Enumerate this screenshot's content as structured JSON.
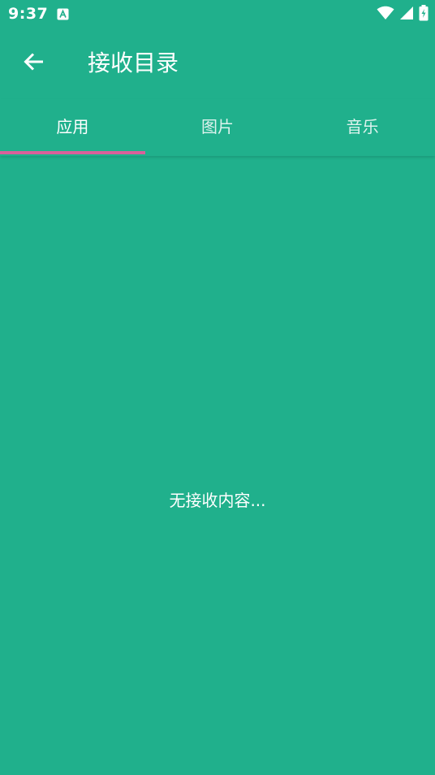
{
  "status_bar": {
    "time": "9:37",
    "notification_icon": "accessibility-a-icon",
    "wifi_icon": "wifi-icon",
    "signal_icon": "cell-signal-icon",
    "battery_icon": "battery-charging-icon"
  },
  "toolbar": {
    "back_icon": "arrow-left-icon",
    "title": "接收目录"
  },
  "tabs": [
    {
      "label": "应用",
      "active": true
    },
    {
      "label": "图片",
      "active": false
    },
    {
      "label": "音乐",
      "active": false
    }
  ],
  "main": {
    "empty_message": "无接收内容..."
  },
  "colors": {
    "background": "#20B08C",
    "tab_indicator": "#D9609A",
    "text": "#FFFFFF"
  }
}
